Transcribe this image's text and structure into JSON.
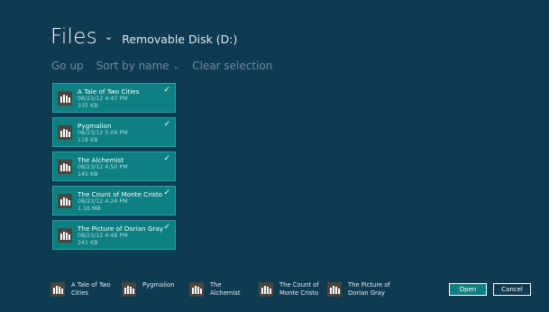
{
  "header": {
    "title": "Files",
    "location": "Removable Disk (D:)"
  },
  "commands": {
    "go_up": "Go up",
    "sort_by": "Sort by name",
    "clear_selection": "Clear selection"
  },
  "files": [
    {
      "name": "A Tale of Two Cities",
      "date": "08/23/12 4:47 PM",
      "size": "335 KB",
      "selected": true
    },
    {
      "name": "Pygmalion",
      "date": "08/23/12 5:04 PM",
      "size": "118 KB",
      "selected": true
    },
    {
      "name": "The Alchemist",
      "date": "08/23/12 4:50 PM",
      "size": "145 KB",
      "selected": true
    },
    {
      "name": "The Count of Monte Cristo",
      "date": "08/23/12 4:24 PM",
      "size": "1.16 MB",
      "selected": true
    },
    {
      "name": "The Picture of Dorian Gray",
      "date": "08/23/12 4:48 PM",
      "size": "241 KB",
      "selected": true
    }
  ],
  "basket": [
    {
      "label": "A Tale of Two Cities"
    },
    {
      "label": "Pygmalion"
    },
    {
      "label": "The Alchemist"
    },
    {
      "label": "The Count of Monte Cristo"
    },
    {
      "label": "The Picture of Dorian Gray"
    }
  ],
  "buttons": {
    "open": "Open",
    "cancel": "Cancel"
  },
  "colors": {
    "background": "#0e3a52",
    "tile": "#0e7f82",
    "tile_border": "#22a6a8",
    "command_text": "#6c8a99",
    "icon_bg": "#4a463e"
  },
  "icons": {
    "file_type": "book-stack-icon",
    "check": "checkmark-icon",
    "dropdown": "chevron-down-icon"
  }
}
